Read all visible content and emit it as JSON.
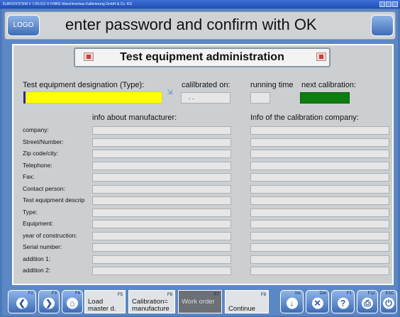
{
  "window": {
    "title": "EUROSYSTEM V 7.00.012  © FINKE Maschinenbau Kalibrierung GmbH & Co. KG"
  },
  "header": {
    "logo_label": "LOGO",
    "title": "enter password and confirm with OK"
  },
  "section": {
    "title": "Test equipment administration"
  },
  "top_fields": {
    "designation_label": "Test equipment designation (Type):",
    "calibrated_label": "calilbrated on:",
    "calibrated_value": ". .",
    "running_label": "running time",
    "next_calibration_label": "next calibration:",
    "colors": {
      "designation_bg": "#ffff00",
      "next_calibration_bg": "#0e7e10"
    }
  },
  "columns": {
    "manufacturer_header": "info about manufacturer:",
    "calibration_header": "Info of the calibration company:"
  },
  "rows": [
    {
      "label": "company:"
    },
    {
      "label": "Street/Number:"
    },
    {
      "label": "Zip code/city:"
    },
    {
      "label": "Telephone:"
    },
    {
      "label": "Fax:"
    },
    {
      "label": "Contact person:"
    },
    {
      "label": "Test equipment descrip"
    },
    {
      "label": "Type:"
    },
    {
      "label": "Equipment:"
    },
    {
      "label": "year of construction:"
    },
    {
      "label": "Serial number:"
    },
    {
      "label": "addition 1:"
    },
    {
      "label": "addition 2:"
    }
  ],
  "bottom_toolbar": {
    "buttons": [
      {
        "key": "F2",
        "icon": "arrow-left-icon",
        "glyph": "❮"
      },
      {
        "key": "F3",
        "icon": "arrow-right-icon",
        "glyph": "❯"
      },
      {
        "key": "F4",
        "icon": "home-icon",
        "glyph": "⌂"
      },
      {
        "key": "F5",
        "label_line1": "Load",
        "label_line2": "master d."
      },
      {
        "key": "F6",
        "label_line1": "Calibration=",
        "label_line2": "manufacture"
      },
      {
        "key": "F7",
        "label_line1": "Work order",
        "label_line2": ""
      },
      {
        "key": "F8",
        "label_line1": "",
        "label_line2": "Continue"
      },
      {
        "key": "Ins",
        "icon": "insert-icon",
        "glyph": "↓"
      },
      {
        "key": "Del",
        "icon": "delete-icon",
        "glyph": "✕"
      },
      {
        "key": "F1",
        "icon": "help-icon",
        "glyph": "?"
      },
      {
        "key": "F12",
        "icon": "print-icon",
        "glyph": "⎙"
      },
      {
        "key": "ESC",
        "icon": "exit-icon",
        "glyph": "⏻"
      }
    ]
  }
}
